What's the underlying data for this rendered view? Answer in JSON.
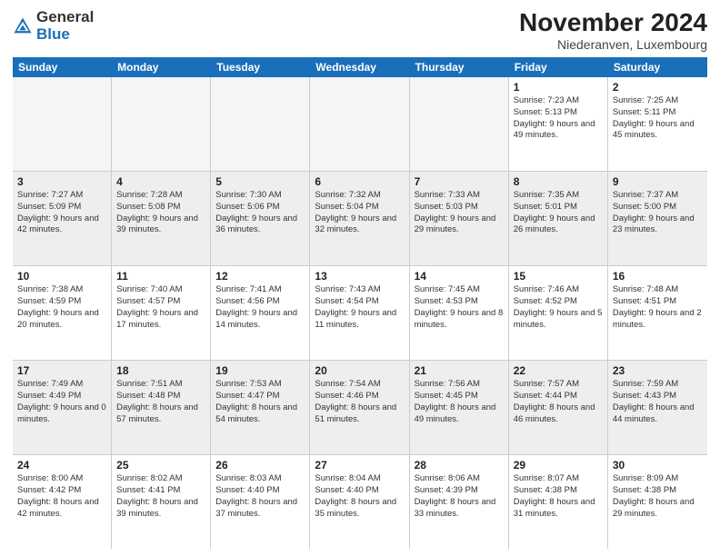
{
  "logo": {
    "text1": "General",
    "text2": "Blue"
  },
  "title": "November 2024",
  "subtitle": "Niederanven, Luxembourg",
  "header_days": [
    "Sunday",
    "Monday",
    "Tuesday",
    "Wednesday",
    "Thursday",
    "Friday",
    "Saturday"
  ],
  "rows": [
    [
      {
        "day": "",
        "info": ""
      },
      {
        "day": "",
        "info": ""
      },
      {
        "day": "",
        "info": ""
      },
      {
        "day": "",
        "info": ""
      },
      {
        "day": "",
        "info": ""
      },
      {
        "day": "1",
        "info": "Sunrise: 7:23 AM\nSunset: 5:13 PM\nDaylight: 9 hours and 49 minutes."
      },
      {
        "day": "2",
        "info": "Sunrise: 7:25 AM\nSunset: 5:11 PM\nDaylight: 9 hours and 45 minutes."
      }
    ],
    [
      {
        "day": "3",
        "info": "Sunrise: 7:27 AM\nSunset: 5:09 PM\nDaylight: 9 hours and 42 minutes."
      },
      {
        "day": "4",
        "info": "Sunrise: 7:28 AM\nSunset: 5:08 PM\nDaylight: 9 hours and 39 minutes."
      },
      {
        "day": "5",
        "info": "Sunrise: 7:30 AM\nSunset: 5:06 PM\nDaylight: 9 hours and 36 minutes."
      },
      {
        "day": "6",
        "info": "Sunrise: 7:32 AM\nSunset: 5:04 PM\nDaylight: 9 hours and 32 minutes."
      },
      {
        "day": "7",
        "info": "Sunrise: 7:33 AM\nSunset: 5:03 PM\nDaylight: 9 hours and 29 minutes."
      },
      {
        "day": "8",
        "info": "Sunrise: 7:35 AM\nSunset: 5:01 PM\nDaylight: 9 hours and 26 minutes."
      },
      {
        "day": "9",
        "info": "Sunrise: 7:37 AM\nSunset: 5:00 PM\nDaylight: 9 hours and 23 minutes."
      }
    ],
    [
      {
        "day": "10",
        "info": "Sunrise: 7:38 AM\nSunset: 4:59 PM\nDaylight: 9 hours and 20 minutes."
      },
      {
        "day": "11",
        "info": "Sunrise: 7:40 AM\nSunset: 4:57 PM\nDaylight: 9 hours and 17 minutes."
      },
      {
        "day": "12",
        "info": "Sunrise: 7:41 AM\nSunset: 4:56 PM\nDaylight: 9 hours and 14 minutes."
      },
      {
        "day": "13",
        "info": "Sunrise: 7:43 AM\nSunset: 4:54 PM\nDaylight: 9 hours and 11 minutes."
      },
      {
        "day": "14",
        "info": "Sunrise: 7:45 AM\nSunset: 4:53 PM\nDaylight: 9 hours and 8 minutes."
      },
      {
        "day": "15",
        "info": "Sunrise: 7:46 AM\nSunset: 4:52 PM\nDaylight: 9 hours and 5 minutes."
      },
      {
        "day": "16",
        "info": "Sunrise: 7:48 AM\nSunset: 4:51 PM\nDaylight: 9 hours and 2 minutes."
      }
    ],
    [
      {
        "day": "17",
        "info": "Sunrise: 7:49 AM\nSunset: 4:49 PM\nDaylight: 9 hours and 0 minutes."
      },
      {
        "day": "18",
        "info": "Sunrise: 7:51 AM\nSunset: 4:48 PM\nDaylight: 8 hours and 57 minutes."
      },
      {
        "day": "19",
        "info": "Sunrise: 7:53 AM\nSunset: 4:47 PM\nDaylight: 8 hours and 54 minutes."
      },
      {
        "day": "20",
        "info": "Sunrise: 7:54 AM\nSunset: 4:46 PM\nDaylight: 8 hours and 51 minutes."
      },
      {
        "day": "21",
        "info": "Sunrise: 7:56 AM\nSunset: 4:45 PM\nDaylight: 8 hours and 49 minutes."
      },
      {
        "day": "22",
        "info": "Sunrise: 7:57 AM\nSunset: 4:44 PM\nDaylight: 8 hours and 46 minutes."
      },
      {
        "day": "23",
        "info": "Sunrise: 7:59 AM\nSunset: 4:43 PM\nDaylight: 8 hours and 44 minutes."
      }
    ],
    [
      {
        "day": "24",
        "info": "Sunrise: 8:00 AM\nSunset: 4:42 PM\nDaylight: 8 hours and 42 minutes."
      },
      {
        "day": "25",
        "info": "Sunrise: 8:02 AM\nSunset: 4:41 PM\nDaylight: 8 hours and 39 minutes."
      },
      {
        "day": "26",
        "info": "Sunrise: 8:03 AM\nSunset: 4:40 PM\nDaylight: 8 hours and 37 minutes."
      },
      {
        "day": "27",
        "info": "Sunrise: 8:04 AM\nSunset: 4:40 PM\nDaylight: 8 hours and 35 minutes."
      },
      {
        "day": "28",
        "info": "Sunrise: 8:06 AM\nSunset: 4:39 PM\nDaylight: 8 hours and 33 minutes."
      },
      {
        "day": "29",
        "info": "Sunrise: 8:07 AM\nSunset: 4:38 PM\nDaylight: 8 hours and 31 minutes."
      },
      {
        "day": "30",
        "info": "Sunrise: 8:09 AM\nSunset: 4:38 PM\nDaylight: 8 hours and 29 minutes."
      }
    ]
  ]
}
